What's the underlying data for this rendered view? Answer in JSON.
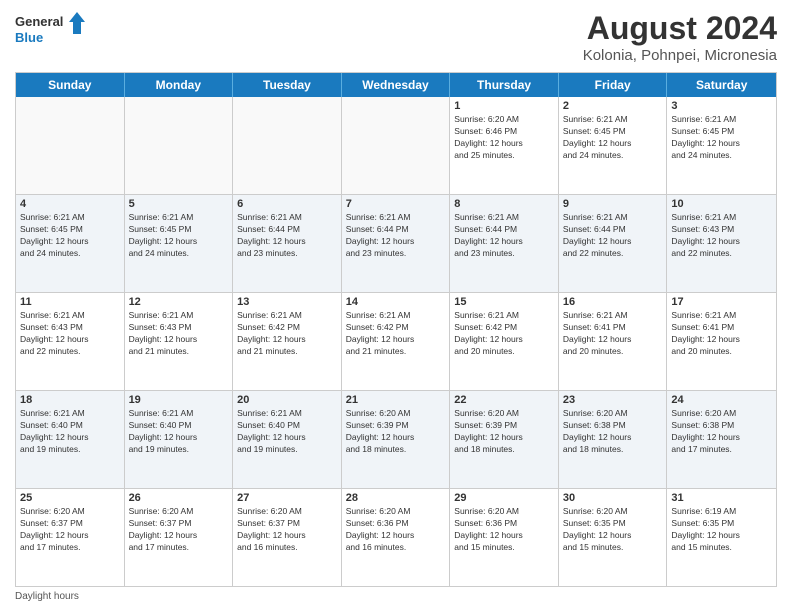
{
  "header": {
    "logo": {
      "line1": "General",
      "line2": "Blue"
    },
    "title": "August 2024",
    "subtitle": "Kolonia, Pohnpei, Micronesia"
  },
  "days_of_week": [
    "Sunday",
    "Monday",
    "Tuesday",
    "Wednesday",
    "Thursday",
    "Friday",
    "Saturday"
  ],
  "weeks": [
    [
      {
        "day": "",
        "info": ""
      },
      {
        "day": "",
        "info": ""
      },
      {
        "day": "",
        "info": ""
      },
      {
        "day": "",
        "info": ""
      },
      {
        "day": "1",
        "info": "Sunrise: 6:20 AM\nSunset: 6:46 PM\nDaylight: 12 hours\nand 25 minutes."
      },
      {
        "day": "2",
        "info": "Sunrise: 6:21 AM\nSunset: 6:45 PM\nDaylight: 12 hours\nand 24 minutes."
      },
      {
        "day": "3",
        "info": "Sunrise: 6:21 AM\nSunset: 6:45 PM\nDaylight: 12 hours\nand 24 minutes."
      }
    ],
    [
      {
        "day": "4",
        "info": "Sunrise: 6:21 AM\nSunset: 6:45 PM\nDaylight: 12 hours\nand 24 minutes."
      },
      {
        "day": "5",
        "info": "Sunrise: 6:21 AM\nSunset: 6:45 PM\nDaylight: 12 hours\nand 24 minutes."
      },
      {
        "day": "6",
        "info": "Sunrise: 6:21 AM\nSunset: 6:44 PM\nDaylight: 12 hours\nand 23 minutes."
      },
      {
        "day": "7",
        "info": "Sunrise: 6:21 AM\nSunset: 6:44 PM\nDaylight: 12 hours\nand 23 minutes."
      },
      {
        "day": "8",
        "info": "Sunrise: 6:21 AM\nSunset: 6:44 PM\nDaylight: 12 hours\nand 23 minutes."
      },
      {
        "day": "9",
        "info": "Sunrise: 6:21 AM\nSunset: 6:44 PM\nDaylight: 12 hours\nand 22 minutes."
      },
      {
        "day": "10",
        "info": "Sunrise: 6:21 AM\nSunset: 6:43 PM\nDaylight: 12 hours\nand 22 minutes."
      }
    ],
    [
      {
        "day": "11",
        "info": "Sunrise: 6:21 AM\nSunset: 6:43 PM\nDaylight: 12 hours\nand 22 minutes."
      },
      {
        "day": "12",
        "info": "Sunrise: 6:21 AM\nSunset: 6:43 PM\nDaylight: 12 hours\nand 21 minutes."
      },
      {
        "day": "13",
        "info": "Sunrise: 6:21 AM\nSunset: 6:42 PM\nDaylight: 12 hours\nand 21 minutes."
      },
      {
        "day": "14",
        "info": "Sunrise: 6:21 AM\nSunset: 6:42 PM\nDaylight: 12 hours\nand 21 minutes."
      },
      {
        "day": "15",
        "info": "Sunrise: 6:21 AM\nSunset: 6:42 PM\nDaylight: 12 hours\nand 20 minutes."
      },
      {
        "day": "16",
        "info": "Sunrise: 6:21 AM\nSunset: 6:41 PM\nDaylight: 12 hours\nand 20 minutes."
      },
      {
        "day": "17",
        "info": "Sunrise: 6:21 AM\nSunset: 6:41 PM\nDaylight: 12 hours\nand 20 minutes."
      }
    ],
    [
      {
        "day": "18",
        "info": "Sunrise: 6:21 AM\nSunset: 6:40 PM\nDaylight: 12 hours\nand 19 minutes."
      },
      {
        "day": "19",
        "info": "Sunrise: 6:21 AM\nSunset: 6:40 PM\nDaylight: 12 hours\nand 19 minutes."
      },
      {
        "day": "20",
        "info": "Sunrise: 6:21 AM\nSunset: 6:40 PM\nDaylight: 12 hours\nand 19 minutes."
      },
      {
        "day": "21",
        "info": "Sunrise: 6:20 AM\nSunset: 6:39 PM\nDaylight: 12 hours\nand 18 minutes."
      },
      {
        "day": "22",
        "info": "Sunrise: 6:20 AM\nSunset: 6:39 PM\nDaylight: 12 hours\nand 18 minutes."
      },
      {
        "day": "23",
        "info": "Sunrise: 6:20 AM\nSunset: 6:38 PM\nDaylight: 12 hours\nand 18 minutes."
      },
      {
        "day": "24",
        "info": "Sunrise: 6:20 AM\nSunset: 6:38 PM\nDaylight: 12 hours\nand 17 minutes."
      }
    ],
    [
      {
        "day": "25",
        "info": "Sunrise: 6:20 AM\nSunset: 6:37 PM\nDaylight: 12 hours\nand 17 minutes."
      },
      {
        "day": "26",
        "info": "Sunrise: 6:20 AM\nSunset: 6:37 PM\nDaylight: 12 hours\nand 17 minutes."
      },
      {
        "day": "27",
        "info": "Sunrise: 6:20 AM\nSunset: 6:37 PM\nDaylight: 12 hours\nand 16 minutes."
      },
      {
        "day": "28",
        "info": "Sunrise: 6:20 AM\nSunset: 6:36 PM\nDaylight: 12 hours\nand 16 minutes."
      },
      {
        "day": "29",
        "info": "Sunrise: 6:20 AM\nSunset: 6:36 PM\nDaylight: 12 hours\nand 15 minutes."
      },
      {
        "day": "30",
        "info": "Sunrise: 6:20 AM\nSunset: 6:35 PM\nDaylight: 12 hours\nand 15 minutes."
      },
      {
        "day": "31",
        "info": "Sunrise: 6:19 AM\nSunset: 6:35 PM\nDaylight: 12 hours\nand 15 minutes."
      }
    ]
  ],
  "footer": {
    "note": "Daylight hours"
  }
}
